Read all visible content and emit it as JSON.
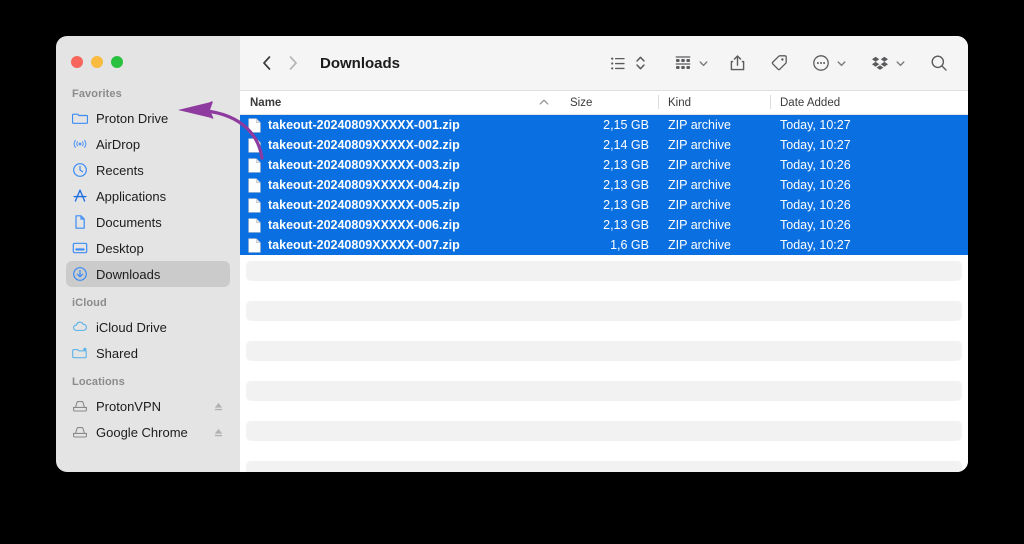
{
  "window": {
    "title": "Downloads",
    "traffic_lights": [
      {
        "name": "close",
        "color": "#f6665c"
      },
      {
        "name": "minimize",
        "color": "#f9bb40"
      },
      {
        "name": "maximize",
        "color": "#2ac040"
      }
    ]
  },
  "toolbar": {
    "back_label": "Back",
    "forward_label": "Forward",
    "title": "Downloads",
    "items": [
      {
        "name": "view-list-icon",
        "label": "List View"
      },
      {
        "name": "sort-order-icon",
        "label": "Sort Order"
      },
      {
        "name": "group-by-icon",
        "label": "Group By"
      },
      {
        "name": "share-icon",
        "label": "Share"
      },
      {
        "name": "tag-icon",
        "label": "Tags"
      },
      {
        "name": "more-options-icon",
        "label": "More"
      },
      {
        "name": "dropbox-icon",
        "label": "Dropbox"
      },
      {
        "name": "search-icon",
        "label": "Search"
      }
    ]
  },
  "sidebar": {
    "sections": [
      {
        "title": "Favorites",
        "items": [
          {
            "label": "Proton Drive",
            "icon": "folder-icon",
            "selected": false,
            "ejectable": false
          },
          {
            "label": "AirDrop",
            "icon": "airdrop-icon",
            "selected": false,
            "ejectable": false
          },
          {
            "label": "Recents",
            "icon": "clock-icon",
            "selected": false,
            "ejectable": false
          },
          {
            "label": "Applications",
            "icon": "applications-icon",
            "selected": false,
            "ejectable": false
          },
          {
            "label": "Documents",
            "icon": "document-icon",
            "selected": false,
            "ejectable": false
          },
          {
            "label": "Desktop",
            "icon": "desktop-icon",
            "selected": false,
            "ejectable": false
          },
          {
            "label": "Downloads",
            "icon": "downloads-icon",
            "selected": true,
            "ejectable": false
          }
        ]
      },
      {
        "title": "iCloud",
        "items": [
          {
            "label": "iCloud Drive",
            "icon": "cloud-icon",
            "selected": false,
            "ejectable": false
          },
          {
            "label": "Shared",
            "icon": "shared-folder-icon",
            "selected": false,
            "ejectable": false
          }
        ]
      },
      {
        "title": "Locations",
        "items": [
          {
            "label": "ProtonVPN",
            "icon": "disk-icon",
            "selected": false,
            "ejectable": true
          },
          {
            "label": "Google Chrome",
            "icon": "disk-icon",
            "selected": false,
            "ejectable": true
          }
        ]
      }
    ]
  },
  "file_list": {
    "columns": [
      "Name",
      "Size",
      "Kind",
      "Date Added"
    ],
    "sort_column": "Name",
    "sort_direction": "ascending",
    "rows": [
      {
        "name": "takeout-20240809XXXXX-001.zip",
        "size": "2,15 GB",
        "kind": "ZIP archive",
        "date": "Today, 10:27",
        "selected": true
      },
      {
        "name": "takeout-20240809XXXXX-002.zip",
        "size": "2,14 GB",
        "kind": "ZIP archive",
        "date": "Today, 10:27",
        "selected": true
      },
      {
        "name": "takeout-20240809XXXXX-003.zip",
        "size": "2,13 GB",
        "kind": "ZIP archive",
        "date": "Today, 10:26",
        "selected": true
      },
      {
        "name": "takeout-20240809XXXXX-004.zip",
        "size": "2,13 GB",
        "kind": "ZIP archive",
        "date": "Today, 10:26",
        "selected": true
      },
      {
        "name": "takeout-20240809XXXXX-005.zip",
        "size": "2,13 GB",
        "kind": "ZIP archive",
        "date": "Today, 10:26",
        "selected": true
      },
      {
        "name": "takeout-20240809XXXXX-006.zip",
        "size": "2,13 GB",
        "kind": "ZIP archive",
        "date": "Today, 10:26",
        "selected": true
      },
      {
        "name": "takeout-20240809XXXXX-007.zip",
        "size": "1,6 GB",
        "kind": "ZIP archive",
        "date": "Today, 10:27",
        "selected": true
      }
    ],
    "empty_stripe_count": 6
  },
  "annotation": {
    "type": "curved-arrow",
    "color": "#8e3a9e",
    "points_to": "Proton Drive",
    "from": "file-list"
  },
  "colors": {
    "selection_blue": "#0a6fe0",
    "sidebar_bg": "#e4e4e4",
    "toolbar_bg": "#f5f5f5",
    "content_bg": "#ffffff",
    "accent_icon_blue": "#3b8cf5",
    "stripe_gray": "#f2f2f2",
    "backdrop": "#000000"
  }
}
